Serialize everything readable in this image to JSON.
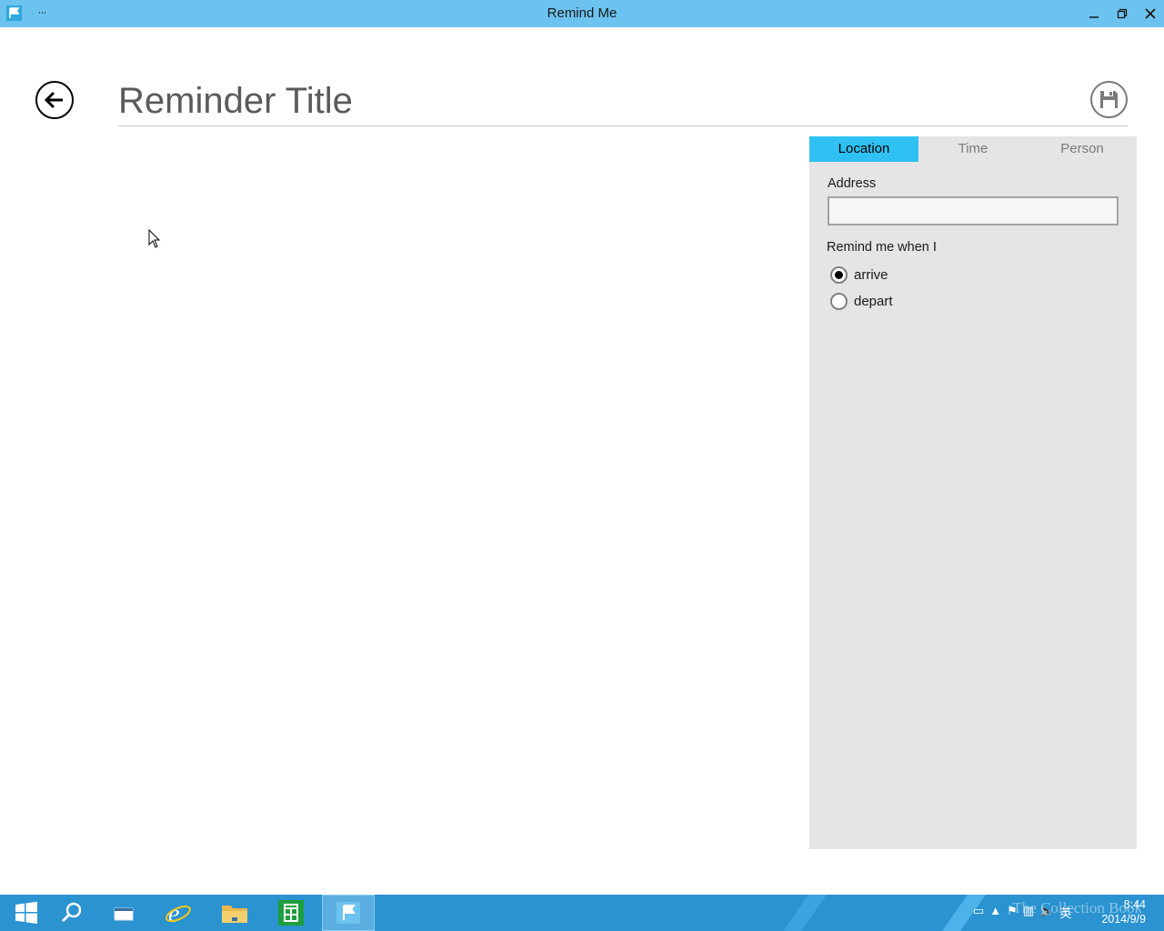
{
  "window": {
    "title": "Remind Me",
    "menu_glyph": "···",
    "accent": "#6cc3ef"
  },
  "header": {
    "title_placeholder": "Reminder Title"
  },
  "panel": {
    "tabs": [
      {
        "label": "Location",
        "active": true
      },
      {
        "label": "Time",
        "active": false
      },
      {
        "label": "Person",
        "active": false
      }
    ],
    "address_label": "Address",
    "address_value": "",
    "remind_label": "Remind me when I",
    "options": [
      {
        "label": "arrive",
        "checked": true
      },
      {
        "label": "depart",
        "checked": false
      }
    ],
    "tab_active_color": "#2fc1f3",
    "background": "#e5e5e5"
  },
  "taskbar": {
    "items": [
      "start-icon",
      "search-icon",
      "task-view-icon",
      "internet-explorer-icon",
      "file-explorer-icon",
      "store-icon",
      "remind-me-app-icon"
    ],
    "tray_ime": "英",
    "clock_time": "8:44",
    "clock_date": "2014/9/9",
    "watermark": "The Collection Book",
    "color": "#2a93d0"
  }
}
